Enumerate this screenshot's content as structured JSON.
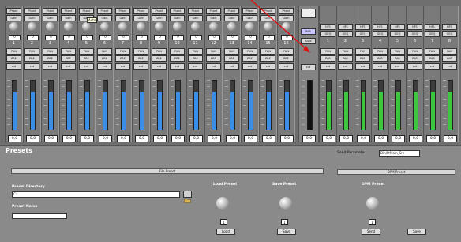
{
  "input_channels": [
    {
      "number": "1",
      "btn1": "Phant",
      "btn2": "Gain",
      "value": "0",
      "pan": "PAN",
      "pre": "PRE",
      "cut": "cut",
      "db": "0,0"
    },
    {
      "number": "2",
      "btn1": "Phant",
      "btn2": "Gain",
      "value": "0",
      "pan": "PAN",
      "pre": "PRE",
      "cut": "cut",
      "db": "0,0"
    },
    {
      "number": "3",
      "btn1": "Phant",
      "btn2": "Gain",
      "value": "0",
      "pan": "PAN",
      "pre": "PRE",
      "cut": "cut",
      "db": "0,0"
    },
    {
      "number": "4",
      "btn1": "Phant",
      "btn2": "Gain",
      "value": "0",
      "pan": "PAN",
      "pre": "PRE",
      "cut": "cut",
      "db": "0,0"
    },
    {
      "number": "5",
      "btn1": "Phant",
      "btn2": "Gain",
      "value": "0",
      "pan": "PAN",
      "pre": "PRE",
      "cut": "cut",
      "db": "0,0"
    },
    {
      "number": "6",
      "btn1": "Phant",
      "btn2": "Gain",
      "value": "0",
      "pan": "PAN",
      "pre": "PRE",
      "cut": "cut",
      "db": "0,0"
    },
    {
      "number": "7",
      "btn1": "Phant",
      "btn2": "Gain",
      "value": "0",
      "pan": "PAN",
      "pre": "PRE",
      "cut": "cut",
      "db": "0,0"
    },
    {
      "number": "8",
      "btn1": "Phant",
      "btn2": "Gain",
      "value": "0",
      "pan": "PAN",
      "pre": "PRE",
      "cut": "cut",
      "db": "0,0"
    },
    {
      "number": "9",
      "btn1": "Phant",
      "btn2": "Gain",
      "value": "0",
      "pan": "PAN",
      "pre": "PRE",
      "cut": "cut",
      "db": "0,0"
    },
    {
      "number": "10",
      "btn1": "Phant",
      "btn2": "Gain",
      "value": "0",
      "pan": "PAN",
      "pre": "PRE",
      "cut": "cut",
      "db": "0,0"
    },
    {
      "number": "11",
      "btn1": "Phant",
      "btn2": "Gain",
      "value": "0",
      "pan": "PAN",
      "pre": "PRE",
      "cut": "cut",
      "db": "0,0"
    },
    {
      "number": "12",
      "btn1": "Phant",
      "btn2": "Gain",
      "value": "0",
      "pan": "PAN",
      "pre": "PRE",
      "cut": "cut",
      "db": "0,0"
    },
    {
      "number": "13",
      "btn1": "Phant",
      "btn2": "Gain",
      "value": "0",
      "pan": "PAN",
      "pre": "PRE",
      "cut": "cut",
      "db": "0,0"
    },
    {
      "number": "14",
      "btn1": "Phant",
      "btn2": "Gain",
      "value": "0",
      "pan": "PAN",
      "pre": "PRE",
      "cut": "cut",
      "db": "0,0"
    },
    {
      "number": "15",
      "btn1": "Phant",
      "btn2": "Gain",
      "value": "0",
      "pan": "PAN",
      "pre": "PRE",
      "cut": "cut",
      "db": "0,0"
    },
    {
      "number": "16",
      "btn1": "Phant",
      "btn2": "Gain",
      "value": "0",
      "pan": "PAN",
      "pre": "PRE",
      "cut": "cut",
      "db": "0,0"
    }
  ],
  "master": {
    "btn1": "",
    "btn2": "PAR",
    "btn3": "Auto",
    "cut": "cut",
    "db": "0,0"
  },
  "output_channels": [
    {
      "number": "1",
      "btn1": "HP1",
      "btn2": "GEQ",
      "pan": "PAN",
      "pre": "PAR",
      "cut": "cut",
      "db": "0,0"
    },
    {
      "number": "2",
      "btn1": "HP1",
      "btn2": "GEQ",
      "pan": "PAN",
      "pre": "PAR",
      "cut": "cut",
      "db": "0,0"
    },
    {
      "number": "3",
      "btn1": "HP1",
      "btn2": "GEQ",
      "pan": "PAN",
      "pre": "PAR",
      "cut": "cut",
      "db": "0,0"
    },
    {
      "number": "4",
      "btn1": "HP1",
      "btn2": "GEQ",
      "pan": "PAN",
      "pre": "PAR",
      "cut": "cut",
      "db": "0,0"
    },
    {
      "number": "5",
      "btn1": "HP1",
      "btn2": "GEQ",
      "pan": "PAN",
      "pre": "PAR",
      "cut": "cut",
      "db": "0,0"
    },
    {
      "number": "6",
      "btn1": "HP1",
      "btn2": "GEQ",
      "pan": "PAN",
      "pre": "PAR",
      "cut": "cut",
      "db": "0,0"
    },
    {
      "number": "7",
      "btn1": "HP1",
      "btn2": "GEQ",
      "pan": "PAN",
      "pre": "PAR",
      "cut": "cut",
      "db": "0,0"
    },
    {
      "number": "8",
      "btn1": "HP1",
      "btn2": "GEQ",
      "pan": "PAN",
      "pre": "PAR",
      "cut": "cut",
      "db": "0,0"
    }
  ],
  "tooltip": "Auto",
  "presets": {
    "title": "Presets",
    "send_parameter_label": "Send Parameter",
    "send_parameter_value": "Din/PrMain_Src",
    "file_preset_bar": "File Preset",
    "dps_preset_bar": "DPM Preset",
    "preset_directory_label": "Preset Directory",
    "preset_directory_value": "C:\\",
    "preset_name_label": "Preset Name",
    "preset_name_value": "",
    "load_preset_label": "Load Preset",
    "save_preset_label": "Save Preset",
    "dpm_preset_label": "DPM Preset",
    "load_number": "1",
    "save_number": "1",
    "dpm_number": "1",
    "load_button": "Load",
    "save_button": "Save",
    "send_button": "Send",
    "save2_button": "Save"
  },
  "colors": {
    "input_meter": "#3a8ee6",
    "output_meter": "#3ec63e",
    "master_meter": "#111111",
    "arrow": "#e01010"
  }
}
